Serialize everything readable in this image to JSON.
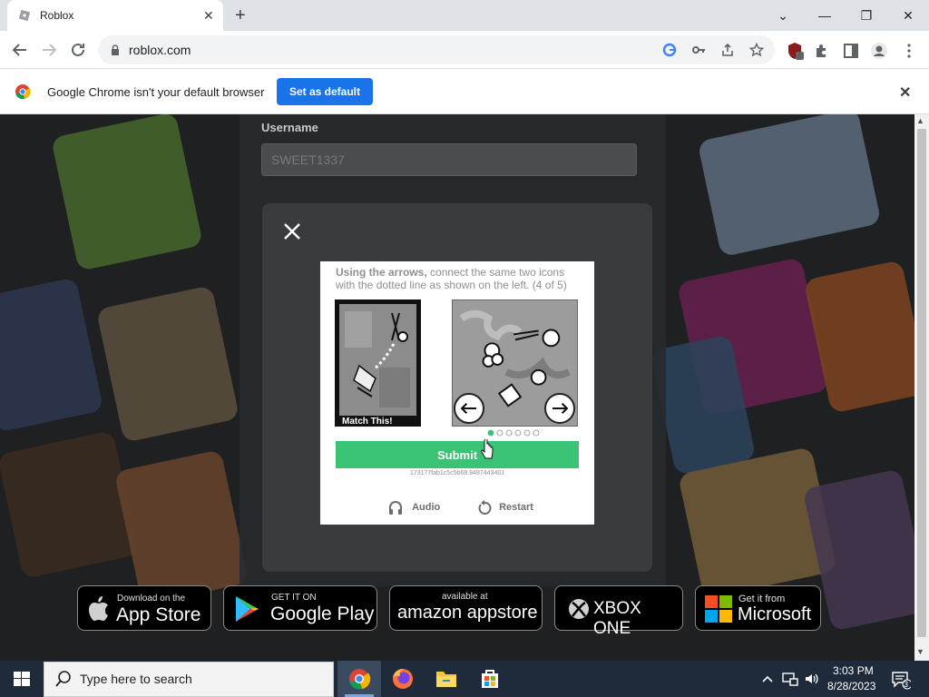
{
  "browser": {
    "tab_title": "Roblox",
    "tab_close": "✕",
    "new_tab": "+",
    "window_minimize": "—",
    "window_restore": "❐",
    "window_close": "✕",
    "window_tabs_menu": "⌄",
    "url": "roblox.com",
    "extension_badge": "2"
  },
  "infobar": {
    "message": "Google Chrome isn't your default browser",
    "button_label": "Set as default",
    "close": "✕"
  },
  "login": {
    "username_label": "Username",
    "username_value": "SWEET1337"
  },
  "captcha": {
    "instruction_bold": "Using the arrows,",
    "instruction_rest": " connect the same two icons with the dotted line as shown on the left. (4 of 5)",
    "match_label": "Match This!",
    "submit_label": "Submit",
    "session_id": "173177fab1c5c5b68.9487443401",
    "audio_label": "Audio",
    "restart_label": "Restart",
    "page_dots_total": 6,
    "page_dots_active": 1
  },
  "store_badges": [
    {
      "small": "Download on the",
      "big": "App Store"
    },
    {
      "small": "GET IT ON",
      "big": "Google Play"
    },
    {
      "small": "available at",
      "big": "amazon appstore"
    },
    {
      "small": "",
      "big": "XBOX ONE"
    },
    {
      "small": "Get it from",
      "big": "Microsoft"
    }
  ],
  "taskbar": {
    "search_placeholder": "Type here to search",
    "time": "3:03 PM",
    "date": "8/28/2023",
    "notification_count": "3"
  },
  "colors": {
    "accent_blue": "#1a73e8",
    "submit_green": "#3ac275",
    "modal_bg": "#393b3d"
  }
}
